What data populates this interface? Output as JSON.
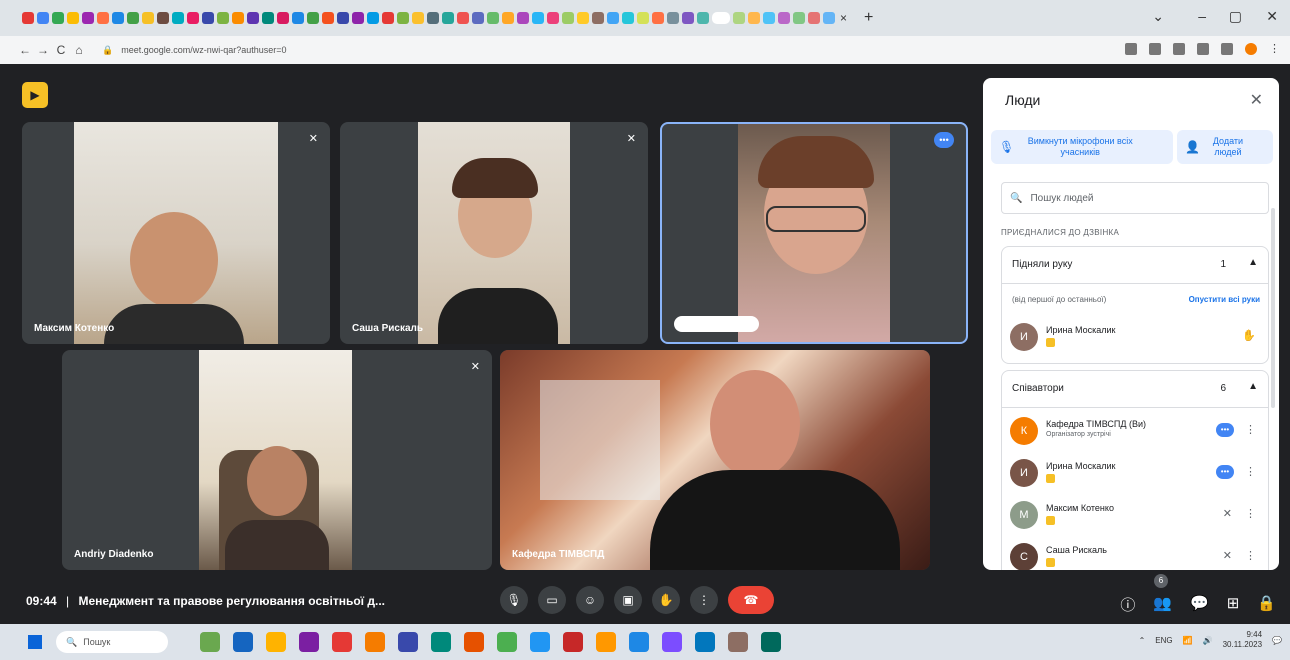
{
  "browser": {
    "tab_icon_colors": [
      "#e53935",
      "#4285f4",
      "#34a853",
      "#fbbc05",
      "#9c27b0",
      "#ff7043",
      "#1e88e5",
      "#43a047",
      "#f6c026",
      "#6d4c41",
      "#00acc1",
      "#e91e63",
      "#3949ab",
      "#7cb342",
      "#fb8c00",
      "#5e35b1",
      "#00897b",
      "#d81b60",
      "#1e88e5",
      "#43a047",
      "#f4511e",
      "#3949ab",
      "#8e24aa",
      "#039be5",
      "#e53935",
      "#7cb342",
      "#fbc02d",
      "#546e7a",
      "#26a69a",
      "#ef5350",
      "#5c6bc0",
      "#66bb6a",
      "#ffa726",
      "#ab47bc",
      "#29b6f6",
      "#ec407a",
      "#9ccc65",
      "#ffca28",
      "#8d6e63",
      "#42a5f5",
      "#26c6da",
      "#d4e157",
      "#ff7043",
      "#78909c",
      "#7e57c2",
      "#4db6ac",
      "#f06292",
      "#aed581",
      "#ffb74d",
      "#4fc3f7",
      "#ba68c8",
      "#81c784",
      "#e57373",
      "#64b5f6"
    ],
    "tab_close": "×",
    "new_tab": "+",
    "win_min": "–",
    "win_max": "▢",
    "win_close": "✕",
    "win_chevron": "⌄",
    "url": "meet.google.com/wz-nwi-qar?authuser=0",
    "back": "←",
    "forward": "→",
    "reload": "C",
    "home": "⌂"
  },
  "meet": {
    "tiles": [
      {
        "name": "Максим Котенко",
        "mic": "✕"
      },
      {
        "name": "Саша Рискаль",
        "mic": "✕"
      },
      {
        "name": "Ирина Москалик",
        "more": "•••"
      },
      {
        "name": "Andriy Diadenko",
        "mic": "✕"
      },
      {
        "name": "Кафедра ТІМВСПД"
      }
    ],
    "time": "09:44",
    "separator": "|",
    "meeting_title": "Менеджмент та правове регулювання освітньої д...",
    "controls": {
      "mic": "🎙",
      "cam": "▭",
      "emoji": "☺",
      "present": "▣",
      "hand": "✋",
      "more": "⋮",
      "end": "☎"
    },
    "right_controls": {
      "info": "ⓘ",
      "people": "👥",
      "chat": "💬",
      "activities": "⊞",
      "host": "🔒"
    },
    "people_count": "6"
  },
  "panel": {
    "title": "Люди",
    "close": "✕",
    "mute_all": "Вимкнути мікрофони всіх учасників",
    "add_people": "Додати людей",
    "search_placeholder": "Пошук людей",
    "joined_label": "ПРИЄДНАЛИСЯ ДО ДЗВІНКА",
    "hands": {
      "title": "Підняли руку",
      "count": "1",
      "sub": "(від першої до останньої)",
      "lower_all": "Опустити всі руки",
      "person": {
        "name": "Ирина Москалик",
        "initial": "И"
      }
    },
    "contributors": {
      "title": "Співавтори",
      "count": "6",
      "people": [
        {
          "name": "Кафедра ТІМВСПД (Ви)",
          "role": "Організатор зустрічі",
          "initial": "К",
          "color": "#f57c00"
        },
        {
          "name": "Ирина Москалик",
          "initial": "И",
          "color": "#795548"
        },
        {
          "name": "Максим Котенко",
          "initial": "М",
          "color": "#8d9c8a"
        },
        {
          "name": "Саша Рискаль",
          "initial": "С",
          "color": "#5d4037"
        }
      ]
    }
  },
  "taskbar": {
    "search": "Пошук",
    "app_colors": [
      "#6aa84f",
      "#1565c0",
      "#ffb300",
      "#7b1fa2",
      "#e53935",
      "#f57c00",
      "#3949ab",
      "#00897b",
      "#e65100",
      "#4caf50",
      "#2196f3",
      "#c62828",
      "#ff9800",
      "#1e88e5",
      "#7c4dff",
      "#0277bd",
      "#8d6e63",
      "#00695c"
    ],
    "lang": "ENG",
    "time": "9:44",
    "date": "30.11.2023"
  }
}
